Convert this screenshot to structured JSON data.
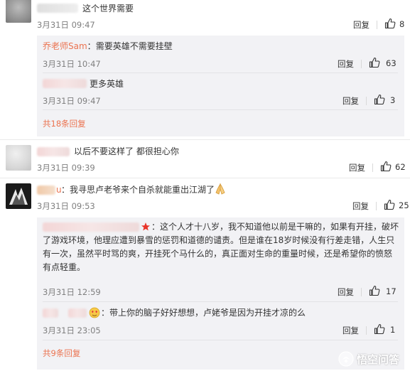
{
  "comments": [
    {
      "text": "这个世界需要",
      "time": "3月31日 09:47",
      "reply": "回复",
      "likes": "8",
      "subs": [
        {
          "user": "乔老师Sam",
          "sep": "：",
          "text": "需要英雄不需要挂壁",
          "time": "3月31日 10:47",
          "reply": "回复",
          "likes": "63"
        },
        {
          "text": "更多英雄",
          "time": "3月31日 09:47",
          "reply": "回复",
          "likes": "3"
        }
      ],
      "more": "共18条回复"
    },
    {
      "text": "以后不要这样了 都很担心你",
      "time": "3月31日 09:39",
      "reply": "回复",
      "likes": "62"
    },
    {
      "text": "我寻思卢老爷来个自杀就能重出江湖了",
      "time": "3月31日 09:53",
      "reply": "回复",
      "likes": "25",
      "subs": [
        {
          "text_lines": [
            "：这个人才十八岁，我不知道他以前是干嘛的，如果有开挂，破坏",
            "了游戏环境，他理应遭到暴雪的惩罚和道德的谴责。但是谁在18岁时候没有行差走错，人生只",
            "有一次，虽然平时骂的爽，开挂死个马什么的，真正面对生命的重量时候，还是希望你的愤怒",
            "有点轻重。"
          ],
          "time": "3月31日 12:59",
          "reply": "回复",
          "likes": "17"
        },
        {
          "text": "：带上你的脑子好好想想，卢姥爷是因为开挂才凉的么",
          "time": "3月31日 23:05",
          "reply": "回复",
          "likes": "1"
        }
      ],
      "more": "共9条回复"
    }
  ],
  "watermark": "悟空问答",
  "colors": {
    "accent": "#eb7350",
    "subbg": "#f2f2f5"
  },
  "icons": [
    "thumb-up-icon",
    "star-icon",
    "emoji-icon",
    "pray-hands-icon",
    "watermark-logo-icon"
  ]
}
